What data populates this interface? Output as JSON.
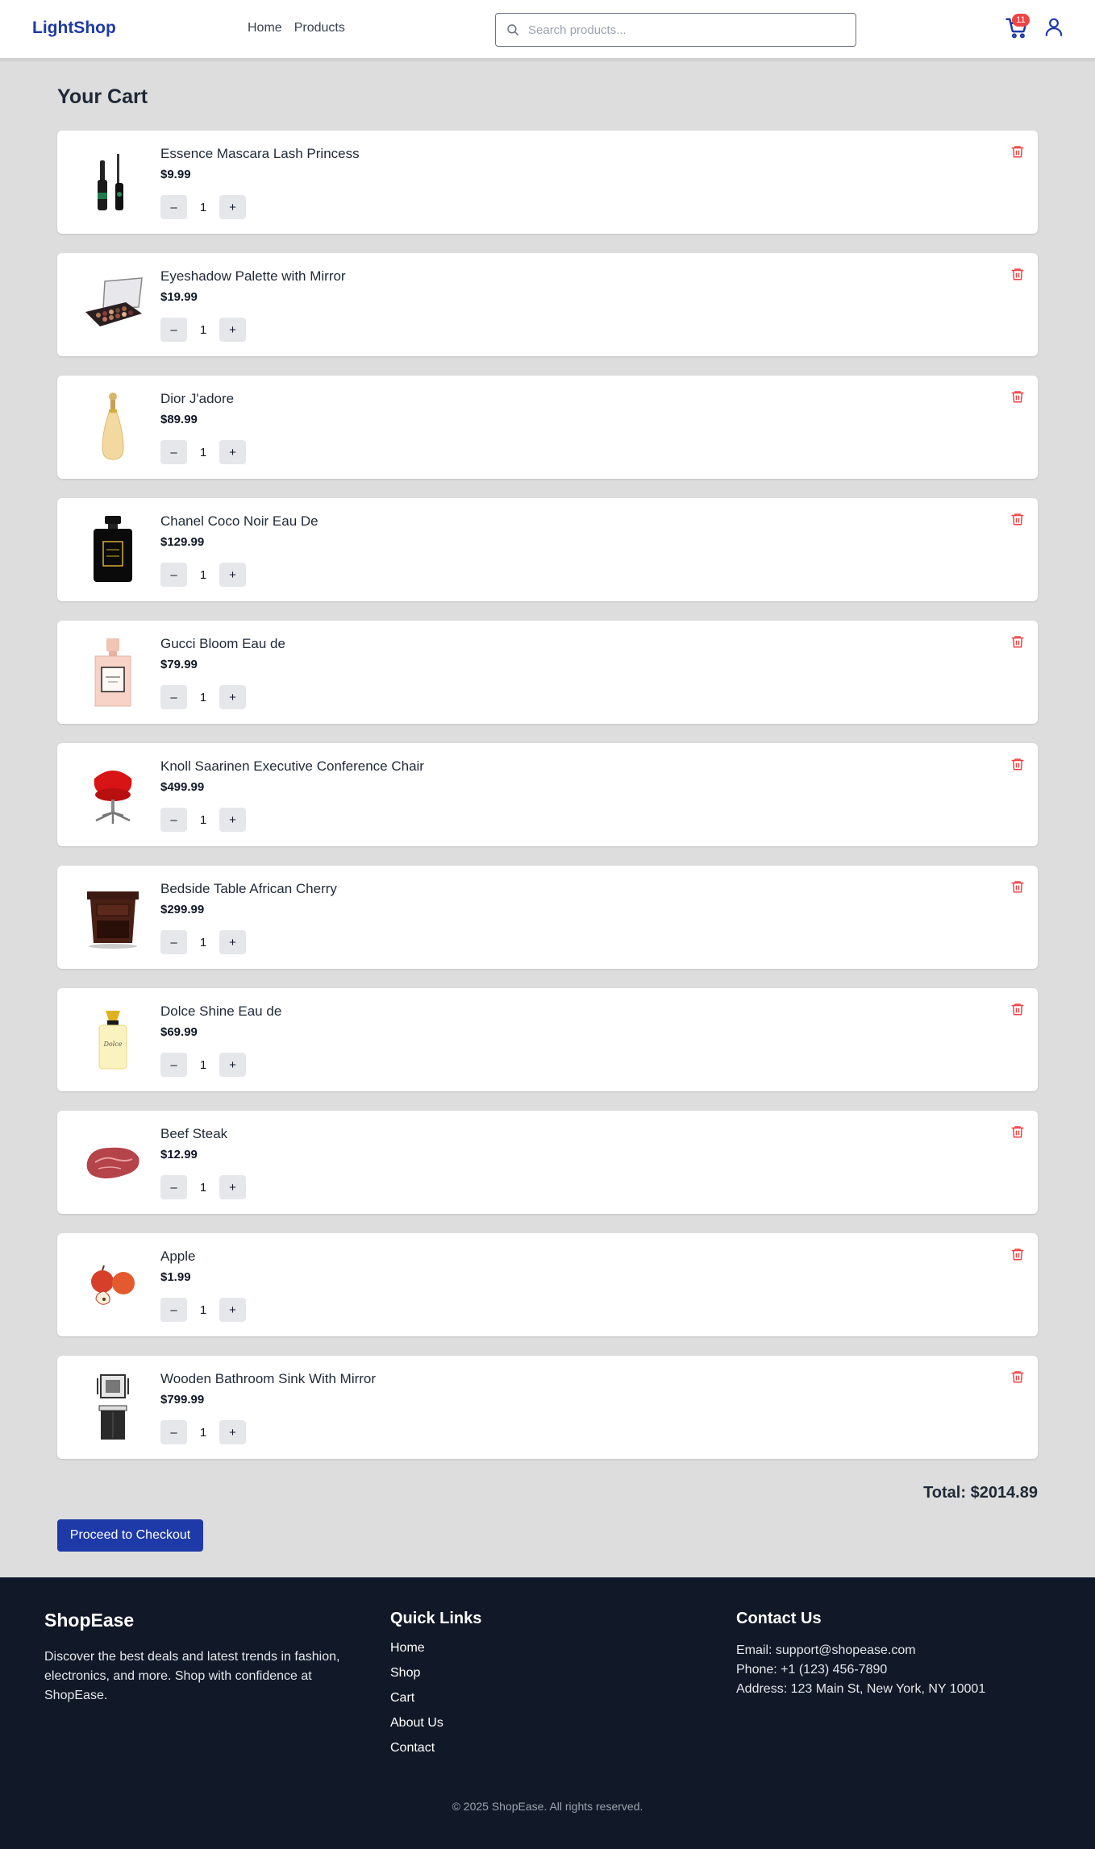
{
  "header": {
    "logo": "LightShop",
    "nav": [
      "Home",
      "Products"
    ],
    "search_placeholder": "Search products...",
    "cart_count": "11",
    "colors": {
      "brand": "#1e3aa8",
      "badge": "#ef4444"
    }
  },
  "cart": {
    "title": "Your Cart",
    "items": [
      {
        "name": "Essence Mascara Lash Princess",
        "price": "$9.99",
        "qty": "1",
        "icon": "mascara-image",
        "minus": "–",
        "plus": "+"
      },
      {
        "name": "Eyeshadow Palette with Mirror",
        "price": "$19.99",
        "qty": "1",
        "icon": "eyeshadow-palette-image",
        "minus": "–",
        "plus": "+"
      },
      {
        "name": "Dior J'adore",
        "price": "$89.99",
        "qty": "1",
        "icon": "perfume-bottle-image",
        "minus": "–",
        "plus": "+"
      },
      {
        "name": "Chanel Coco Noir Eau De",
        "price": "$129.99",
        "qty": "1",
        "icon": "perfume-bottle-image",
        "minus": "–",
        "plus": "+"
      },
      {
        "name": "Gucci Bloom Eau de",
        "price": "$79.99",
        "qty": "1",
        "icon": "perfume-bottle-image",
        "minus": "–",
        "plus": "+"
      },
      {
        "name": "Knoll Saarinen Executive Conference Chair",
        "price": "$499.99",
        "qty": "1",
        "icon": "chair-image",
        "minus": "–",
        "plus": "+"
      },
      {
        "name": "Bedside Table African Cherry",
        "price": "$299.99",
        "qty": "1",
        "icon": "bedside-table-image",
        "minus": "–",
        "plus": "+"
      },
      {
        "name": "Dolce Shine Eau de",
        "price": "$69.99",
        "qty": "1",
        "icon": "perfume-bottle-image",
        "minus": "–",
        "plus": "+"
      },
      {
        "name": "Beef Steak",
        "price": "$12.99",
        "qty": "1",
        "icon": "steak-image",
        "minus": "–",
        "plus": "+"
      },
      {
        "name": "Apple",
        "price": "$1.99",
        "qty": "1",
        "icon": "apple-image",
        "minus": "–",
        "plus": "+"
      },
      {
        "name": "Wooden Bathroom Sink With Mirror",
        "price": "$799.99",
        "qty": "1",
        "icon": "bathroom-sink-image",
        "minus": "–",
        "plus": "+"
      }
    ],
    "total": "Total: $2014.89",
    "checkout_label": "Proceed to Checkout",
    "colors": {
      "delete": "#ef4444"
    }
  },
  "footer": {
    "brand": "ShopEase",
    "description": "Discover the best deals and latest trends in fashion, electronics, and more. Shop with confidence at ShopEase.",
    "quick_links_title": "Quick Links",
    "quick_links": [
      "Home",
      "Shop",
      "Cart",
      "About Us",
      "Contact"
    ],
    "contact_title": "Contact Us",
    "contact": {
      "email": "Email: support@shopease.com",
      "phone": "Phone: +1 (123) 456-7890",
      "address": "Address: 123 Main St, New York, NY 10001"
    },
    "copyright": "© 2025 ShopEase. All rights reserved."
  }
}
